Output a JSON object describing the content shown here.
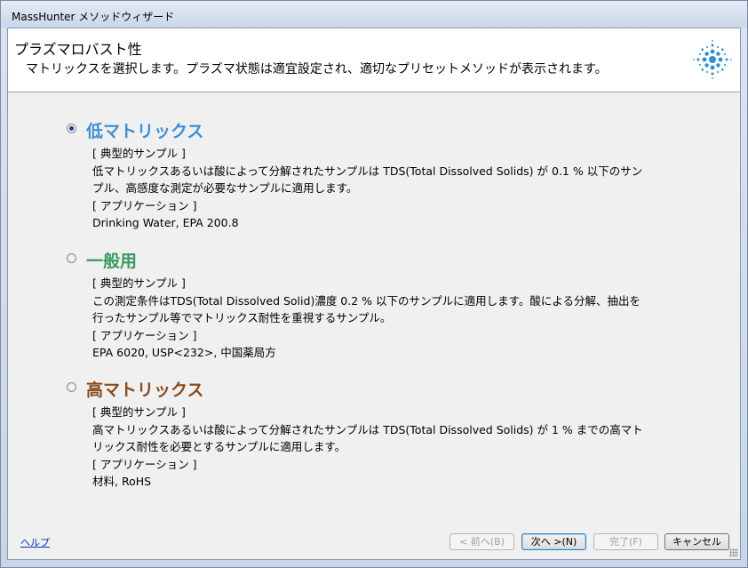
{
  "window": {
    "title": "MassHunter メソッドウィザード"
  },
  "header": {
    "title": "プラズマロバスト性",
    "description": "マトリックスを選択します。プラズマ状態は適宜設定され、適切なプリセットメソッドが表示されます。",
    "logo_icon": "agilent-spark-icon"
  },
  "options": [
    {
      "title": "低マトリックス",
      "color": "#3b8fd9",
      "checked": true,
      "sample_heading": "[ 典型的サンプル ]",
      "sample_lines": [
        "低マトリックスあるいは酸によって分解されたサンプルは TDS(Total Dissolved Solids) が 0.1 % 以下のサン",
        "プル、高感度な測定が必要なサンプルに適用します。"
      ],
      "app_heading": "[ アプリケーション ]",
      "app_value": "Drinking Water, EPA 200.8"
    },
    {
      "title": "一般用",
      "color": "#3a9a5c",
      "checked": false,
      "sample_heading": "[ 典型的サンプル ]",
      "sample_lines": [
        "この測定条件はTDS(Total Dissolved Solid)濃度 0.2 % 以下のサンプルに適用します。酸による分解、抽出を",
        "行ったサンプル等でマトリックス耐性を重視するサンプル。"
      ],
      "app_heading": "[ アプリケーション ]",
      "app_value": "EPA 6020, USP<232>, 中国薬局方"
    },
    {
      "title": "高マトリックス",
      "color": "#8b4a1c",
      "checked": false,
      "sample_heading": "[ 典型的サンプル ]",
      "sample_lines": [
        "高マトリックスあるいは酸によって分解されたサンプルは TDS(Total Dissolved Solids) が 1 % までの高マト",
        "リックス耐性を必要とするサンプルに適用します。"
      ],
      "app_heading": "[ アプリケーション ]",
      "app_value": "材料, RoHS"
    }
  ],
  "footer": {
    "help_label": "ヘルプ",
    "back_label": "< 前へ(B)",
    "next_label": "次へ >(N)",
    "finish_label": "完了(F)",
    "cancel_label": "キャンセル"
  }
}
